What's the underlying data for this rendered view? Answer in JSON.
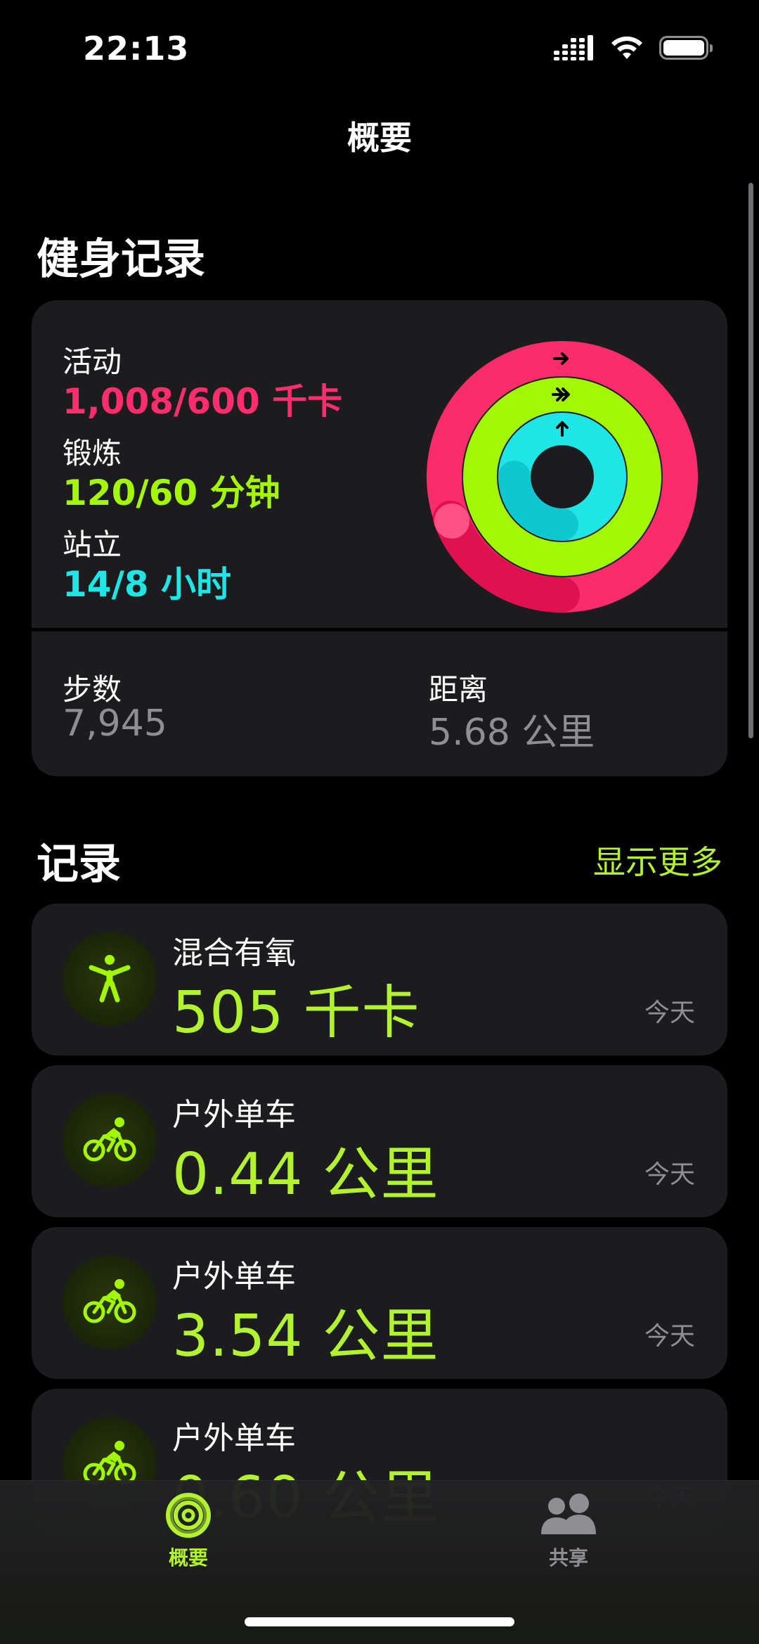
{
  "status_bar": {
    "time": "22:13",
    "signal_icon": "cellular-signal-icon",
    "wifi_icon": "wifi-icon",
    "battery_icon": "battery-icon",
    "battery_level": 1.0
  },
  "nav": {
    "title": "概要"
  },
  "fitness": {
    "section_title": "健身记录",
    "move": {
      "label": "活动",
      "value": "1,008/600 千卡",
      "progress": 1.68,
      "color": "#ff2d6e"
    },
    "exercise": {
      "label": "锻炼",
      "value": "120/60 分钟",
      "progress": 2.0,
      "color": "#a3f705"
    },
    "stand": {
      "label": "站立",
      "value": "14/8 小时",
      "progress": 1.75,
      "color": "#1fe6e6"
    },
    "steps": {
      "label": "步数",
      "value": "7,945"
    },
    "distance": {
      "label": "距离",
      "value": "5.68 公里"
    }
  },
  "records": {
    "section_title": "记录",
    "show_more": "显示更多",
    "items": [
      {
        "name": "混合有氧",
        "value": "505 千卡",
        "date": "今天",
        "icon": "mixed-cardio-icon"
      },
      {
        "name": "户外单车",
        "value": "0.44 公里",
        "date": "今天",
        "icon": "outdoor-cycling-icon"
      },
      {
        "name": "户外单车",
        "value": "3.54 公里",
        "date": "今天",
        "icon": "outdoor-cycling-icon"
      },
      {
        "name": "户外单车",
        "value": "0.60 公里",
        "date": "今天",
        "icon": "outdoor-cycling-icon"
      }
    ]
  },
  "tab_bar": {
    "tabs": [
      {
        "label": "概要",
        "icon": "activity-rings-icon",
        "active": true
      },
      {
        "label": "共享",
        "icon": "sharing-people-icon",
        "active": false
      }
    ]
  },
  "colors": {
    "accent": "#b2f22f",
    "card_bg": "#1c1c1e",
    "secondary_text": "#8e8e93",
    "inactive_tab": "#8e8e93"
  }
}
